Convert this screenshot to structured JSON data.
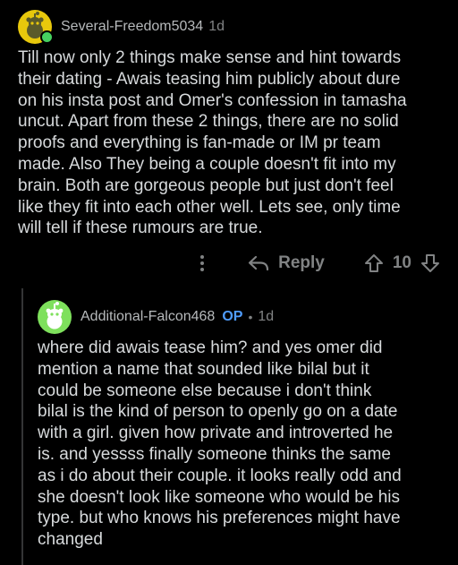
{
  "colors": {
    "background": "#000000",
    "text": "#d7dadc",
    "muted": "#818384",
    "op_badge": "#4f9dff",
    "online": "#46d160",
    "avatar_yellow": "#e8c80c",
    "avatar_green": "#7ee05c"
  },
  "comment": {
    "avatar_icon": "snoo-avatar-icon",
    "username": "Several-Freedom5034",
    "time": "1d",
    "lines": [
      "Till now only 2 things make sense and hint towards",
      "their dating - Awais teasing him publicly about dure",
      "on his insta post and Omer's confession in tamasha",
      "uncut. Apart from these 2 things, there are no solid",
      "proofs and everything is fan-made or IM pr team",
      "made. Also They being a couple doesn't fit into my",
      "brain. Both are gorgeous people but just don't feel",
      "like they fit into each other well. Lets see, only time",
      "will tell if these rumours are true."
    ],
    "actions": {
      "more_icon": "more-vertical-icon",
      "reply_icon": "reply-arrow-icon",
      "reply_label": "Reply",
      "upvote_icon": "upvote-arrow-icon",
      "score": "10",
      "downvote_icon": "downvote-arrow-icon"
    }
  },
  "reply": {
    "avatar_icon": "snoo-avatar-icon",
    "username": "Additional-Falcon468",
    "op_label": "OP",
    "separator": "•",
    "time": "1d",
    "lines": [
      "where did awais tease him? and yes omer did",
      "mention a name that sounded like bilal but it",
      "could be someone else because i don't think",
      "bilal is the kind of person to openly go on a date",
      "with a girl. given how private and introverted he",
      "is. and yessss finally someone thinks the same",
      "as i do about their couple. it looks really odd and",
      "she doesn't look like someone who would be his",
      "type. but who knows his preferences might have",
      "changed"
    ]
  }
}
